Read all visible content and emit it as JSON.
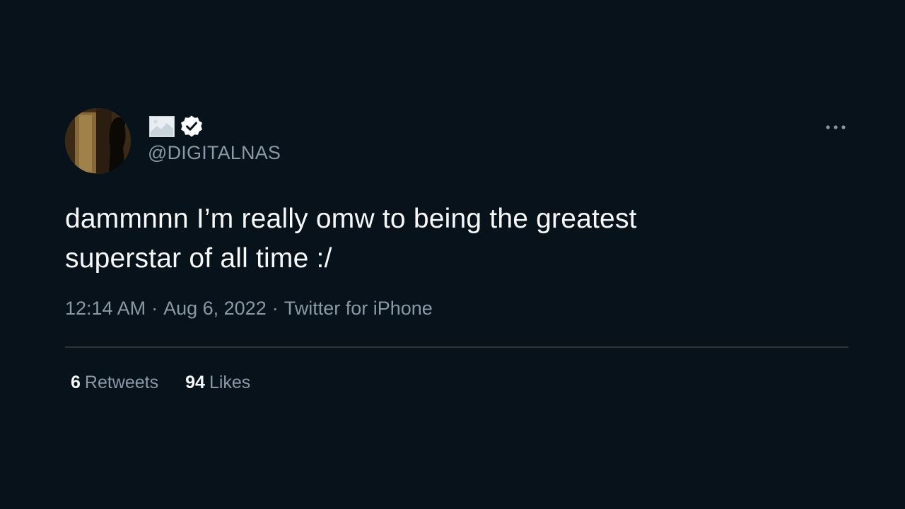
{
  "author": {
    "avatar_icon": "profile-photo",
    "name_emoji_icon": "landscape-image-emoji",
    "verified_icon": "verified-badge-icon",
    "handle": "@DIGITALNAS"
  },
  "menu": {
    "icon": "more-options-icon"
  },
  "tweet": {
    "text_line_1": "dammnnn I’m really omw to being the greatest",
    "text_line_2": "superstar of all time :/"
  },
  "meta": {
    "time": "12:14 AM",
    "separator": "·",
    "date": "Aug 6, 2022",
    "source": "Twitter for iPhone"
  },
  "stats": {
    "retweets_count": "6",
    "retweets_label": "Retweets",
    "likes_count": "94",
    "likes_label": "Likes"
  },
  "colors": {
    "background": "#08121b",
    "text_primary": "#f7f9f9",
    "text_secondary": "#8b98a5",
    "divider": "#2f3336"
  }
}
